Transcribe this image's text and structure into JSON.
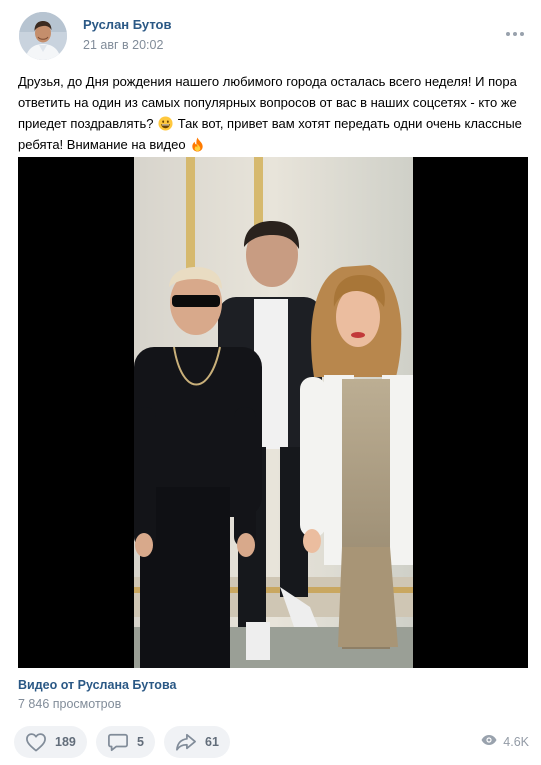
{
  "author": {
    "name": "Руслан Бутов",
    "date": "21 авг в 20:02"
  },
  "post": {
    "text_part1": "Друзья, до Дня рождения нашего любимого города осталась всего неделя! И пора ответить на один из самых популярных вопросов от вас в наших соцсетях - кто же приедет поздравлять?",
    "text_part2": "Так вот, привет вам хотят передать одни очень классные ребята! Внимание на видео",
    "emoji_1": "grinning-face-icon",
    "emoji_2": "fire-icon"
  },
  "video": {
    "title": "Видео от Руслана Бутова",
    "views": "7 846 просмотров"
  },
  "actions": {
    "likes": "189",
    "comments": "5",
    "shares": "61",
    "views": "4.6K"
  },
  "colors": {
    "link": "#2a5885",
    "secondary_text": "#818c99",
    "button_bg": "#f0f2f5"
  }
}
